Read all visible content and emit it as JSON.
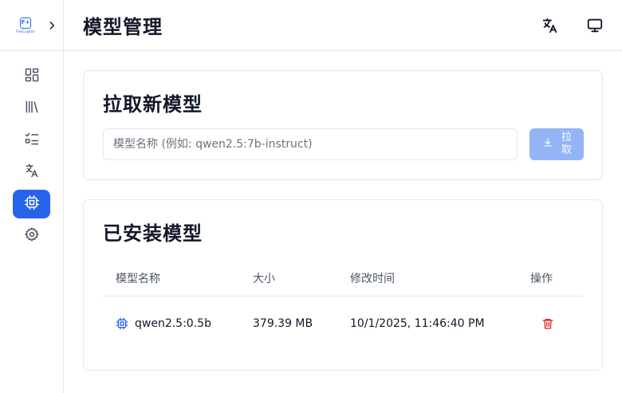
{
  "app": {
    "logo_text": "FlexCaption",
    "logo_mark": "F+"
  },
  "sidebar": {
    "items": [
      {
        "name": "dashboard",
        "icon": "dashboard-icon",
        "active": false
      },
      {
        "name": "library",
        "icon": "library-icon",
        "active": false
      },
      {
        "name": "tasks",
        "icon": "list-check-icon",
        "active": false
      },
      {
        "name": "translate",
        "icon": "translate-icon",
        "active": false
      },
      {
        "name": "models",
        "icon": "cpu-icon",
        "active": true
      },
      {
        "name": "settings",
        "icon": "gear-icon",
        "active": false
      }
    ]
  },
  "header": {
    "title": "模型管理",
    "icons": [
      "language-icon",
      "monitor-icon"
    ]
  },
  "pull_card": {
    "title": "拉取新模型",
    "input_placeholder": "模型名称 (例如: qwen2.5:7b-instruct)",
    "input_value": "",
    "button_label": "拉取"
  },
  "models_card": {
    "title": "已安装模型",
    "columns": [
      "模型名称",
      "大小",
      "修改时间",
      "操作"
    ],
    "rows": [
      {
        "name": "qwen2.5:0.5b",
        "size": "379.39 MB",
        "modified": "10/1/2025, 11:46:40 PM"
      }
    ]
  },
  "colors": {
    "accent": "#2563eb",
    "accent_disabled": "#93b4f5",
    "danger": "#dc2626",
    "border": "#e5e7eb"
  }
}
